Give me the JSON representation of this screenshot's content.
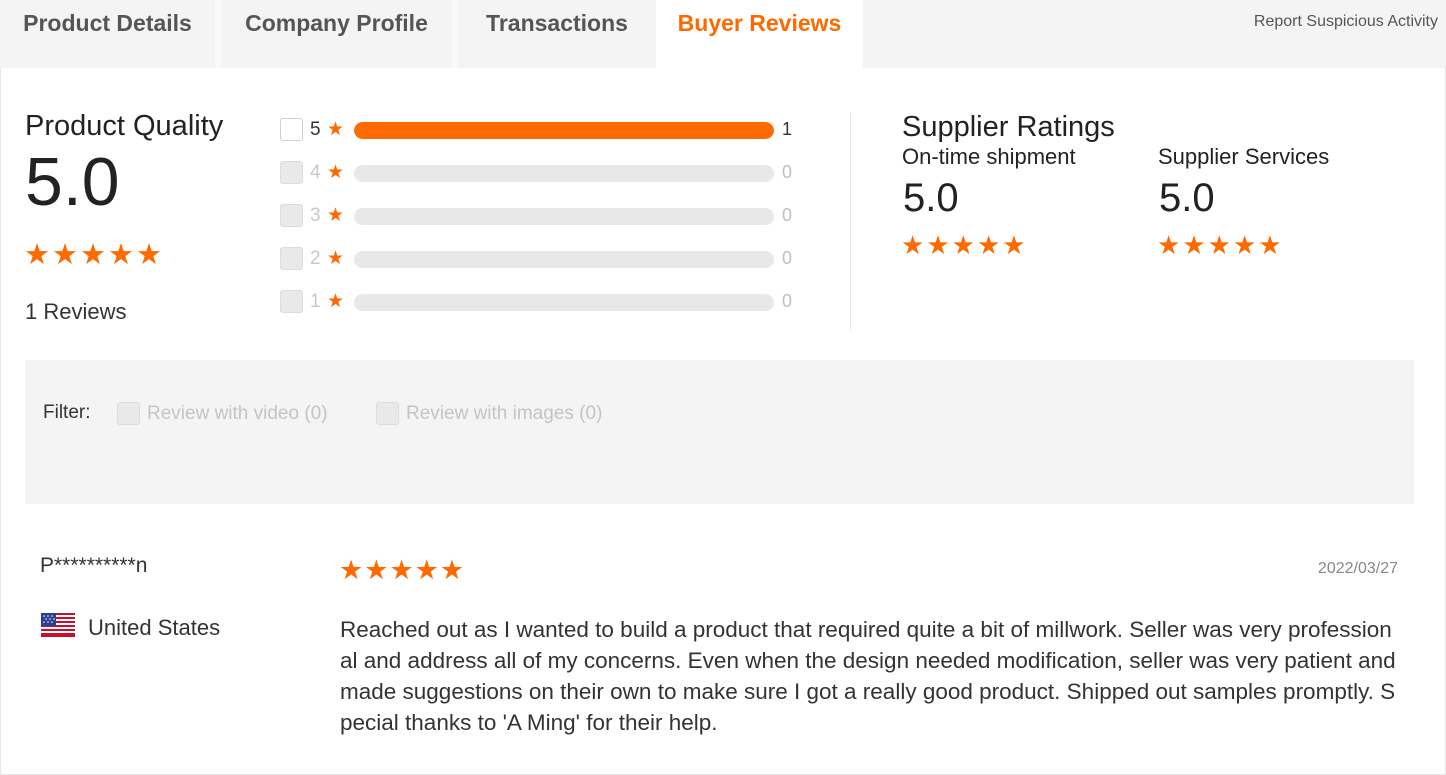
{
  "tabs": [
    {
      "label": "Product Details",
      "active": false
    },
    {
      "label": "Company Profile",
      "active": false
    },
    {
      "label": "Transactions",
      "active": false
    },
    {
      "label": "Buyer Reviews",
      "active": true
    }
  ],
  "report_link": "Report Suspicious Activity",
  "product_quality": {
    "title": "Product Quality",
    "score": "5.0",
    "stars": 5,
    "reviews_label": "1 Reviews"
  },
  "rating_breakdown": [
    {
      "stars": "5",
      "count": "1",
      "fill_fraction": 1.0,
      "enabled": true
    },
    {
      "stars": "4",
      "count": "0",
      "fill_fraction": 0,
      "enabled": false
    },
    {
      "stars": "3",
      "count": "0",
      "fill_fraction": 0,
      "enabled": false
    },
    {
      "stars": "2",
      "count": "0",
      "fill_fraction": 0,
      "enabled": false
    },
    {
      "stars": "1",
      "count": "0",
      "fill_fraction": 0,
      "enabled": false
    }
  ],
  "supplier_ratings": {
    "title": "Supplier Ratings",
    "on_time_label": "On-time shipment",
    "on_time_score": "5.0",
    "services_label": "Supplier Services",
    "services_score": "5.0",
    "stars": 5
  },
  "filter": {
    "label": "Filter:",
    "video_option": "Review with video (0)",
    "images_option": "Review with images (0)"
  },
  "review": {
    "reviewer": "P**********n",
    "country": "United States",
    "flag": "us-flag-icon",
    "stars": 5,
    "date": "2022/03/27",
    "text": "Reached out as I wanted to build a product that required quite a bit of millwork. Seller was very professional and address all of my concerns. Even when the design needed modification, seller was very patient and made suggestions on their own to make sure I got a really good product. Shipped out samples promptly. Special thanks to 'A Ming' for their help."
  },
  "colors": {
    "accent": "#ff6a00",
    "tab_bg": "#f4f4f4",
    "panel_bg": "#f4f4f4",
    "track": "#e8e8e8"
  }
}
